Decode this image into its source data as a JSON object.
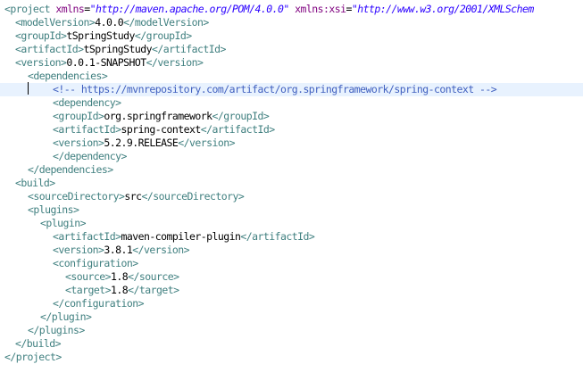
{
  "editor": {
    "lines": [
      [
        {
          "t": "<project ",
          "c": "tag"
        },
        {
          "t": "xmlns",
          "c": "attr"
        },
        {
          "t": "=",
          "c": "txt"
        },
        {
          "t": "\"http://maven.apache.org/POM/4.0.0\"",
          "c": "val"
        },
        {
          "t": " ",
          "c": "txt"
        },
        {
          "t": "xmlns:xsi",
          "c": "attr"
        },
        {
          "t": "=",
          "c": "txt"
        },
        {
          "t": "\"http://www.w3.org/2001/XMLSchem",
          "c": "val"
        }
      ],
      [
        {
          "t": "<modelVersion>",
          "c": "tag"
        },
        {
          "t": "4.0.0",
          "c": "txt"
        },
        {
          "t": "</modelVersion>",
          "c": "tag"
        }
      ],
      [
        {
          "t": "<groupId>",
          "c": "tag"
        },
        {
          "t": "tSpringStudy",
          "c": "txt"
        },
        {
          "t": "</groupId>",
          "c": "tag"
        }
      ],
      [
        {
          "t": "<artifactId>",
          "c": "tag"
        },
        {
          "t": "tSpringStudy",
          "c": "txt"
        },
        {
          "t": "</artifactId>",
          "c": "tag"
        }
      ],
      [
        {
          "t": "<version>",
          "c": "tag"
        },
        {
          "t": "0.0.1-SNAPSHOT",
          "c": "txt"
        },
        {
          "t": "</version>",
          "c": "tag"
        }
      ],
      [
        {
          "t": "<dependencies>",
          "c": "tag"
        }
      ],
      [
        {
          "t": "<!-- https://mvnrepository.com/artifact/org.springframework/spring-context -->",
          "c": "cmt"
        }
      ],
      [
        {
          "t": "<dependency>",
          "c": "tag"
        }
      ],
      [
        {
          "t": "<groupId>",
          "c": "tag"
        },
        {
          "t": "org.springframework",
          "c": "txt"
        },
        {
          "t": "</groupId>",
          "c": "tag"
        }
      ],
      [
        {
          "t": "<artifactId>",
          "c": "tag"
        },
        {
          "t": "spring-context",
          "c": "txt"
        },
        {
          "t": "</artifactId>",
          "c": "tag"
        }
      ],
      [
        {
          "t": "<version>",
          "c": "tag"
        },
        {
          "t": "5.2.9.RELEASE",
          "c": "txt"
        },
        {
          "t": "</version>",
          "c": "tag"
        }
      ],
      [
        {
          "t": "</dependency>",
          "c": "tag"
        }
      ],
      [
        {
          "t": "</dependencies>",
          "c": "tag"
        }
      ],
      [
        {
          "t": "<build>",
          "c": "tag"
        }
      ],
      [
        {
          "t": "<sourceDirectory>",
          "c": "tag"
        },
        {
          "t": "src",
          "c": "txt"
        },
        {
          "t": "</sourceDirectory>",
          "c": "tag"
        }
      ],
      [
        {
          "t": "<plugins>",
          "c": "tag"
        }
      ],
      [
        {
          "t": "<plugin>",
          "c": "tag"
        }
      ],
      [
        {
          "t": "<artifactId>",
          "c": "tag"
        },
        {
          "t": "maven-compiler-plugin",
          "c": "txt"
        },
        {
          "t": "</artifactId>",
          "c": "tag"
        }
      ],
      [
        {
          "t": "<version>",
          "c": "tag"
        },
        {
          "t": "3.8.1",
          "c": "txt"
        },
        {
          "t": "</version>",
          "c": "tag"
        }
      ],
      [
        {
          "t": "<configuration>",
          "c": "tag"
        }
      ],
      [
        {
          "t": "<source>",
          "c": "tag"
        },
        {
          "t": "1.8",
          "c": "txt"
        },
        {
          "t": "</source>",
          "c": "tag"
        }
      ],
      [
        {
          "t": "<target>",
          "c": "tag"
        },
        {
          "t": "1.8",
          "c": "txt"
        },
        {
          "t": "</target>",
          "c": "tag"
        }
      ],
      [
        {
          "t": "</configuration>",
          "c": "tag"
        }
      ],
      [
        {
          "t": "</plugin>",
          "c": "tag"
        }
      ],
      [
        {
          "t": "</plugins>",
          "c": "tag"
        }
      ],
      [
        {
          "t": "</build>",
          "c": "tag"
        }
      ],
      [
        {
          "t": "</project>",
          "c": "tag"
        }
      ]
    ],
    "colors": {
      "tag": "#3f7f7f",
      "attribute": "#7f007f",
      "value": "#2a00ff",
      "comment": "#3f5fbf",
      "text": "#000000",
      "current_line": "#e8f2fe"
    }
  }
}
